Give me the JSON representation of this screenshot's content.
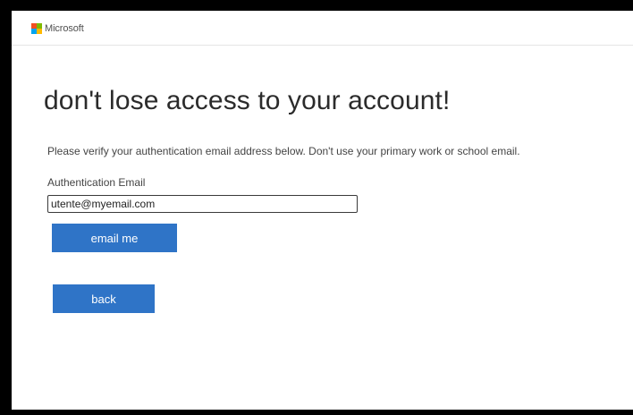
{
  "brand": {
    "name": "Microsoft",
    "logo_colors": [
      "#f25022",
      "#7fba00",
      "#00a4ef",
      "#ffb900"
    ]
  },
  "page": {
    "heading": "don't lose access to your account!",
    "instructions": "Please verify your authentication email address below. Don't use your primary work or school email."
  },
  "form": {
    "email_label": "Authentication Email",
    "email_value": "utente@myemail.com"
  },
  "buttons": {
    "email_me_label": "email me",
    "back_label": "back"
  },
  "colors": {
    "button_bg": "#2f74c7",
    "background": "#ffffff",
    "frame": "#000000"
  }
}
